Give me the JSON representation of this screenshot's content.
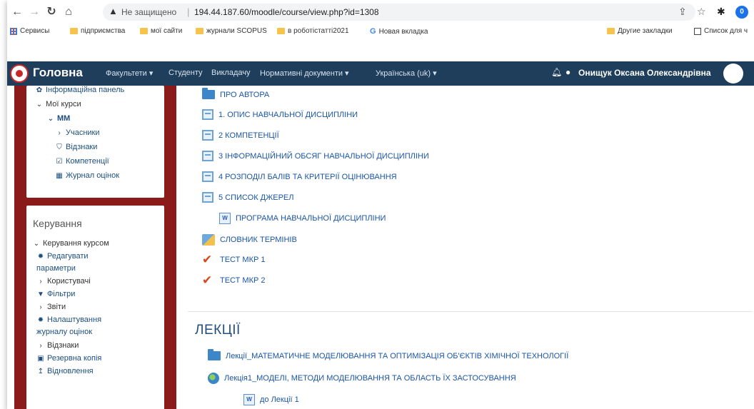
{
  "browser": {
    "not_secure": "Не защищено",
    "url": "194.44.187.60/moodle/course/view.php?id=1308",
    "profile_initial": "0"
  },
  "bookmarks": {
    "left": [
      "Сервисы",
      "підприємства",
      "мої сайти",
      "журнали SCOPUS",
      "в роботістатті2021",
      "Новая вкладка"
    ],
    "right": [
      "Другие закладки",
      "Список для ч"
    ]
  },
  "topnav": {
    "home": "Головна",
    "items": [
      "Факультети ▾",
      "Студенту",
      "Викладачу",
      "Нормативні документи ▾",
      "Українська (uk) ▾"
    ],
    "user": "Онищук Оксана Олександрівна"
  },
  "sidebar": {
    "nav": {
      "dashboard": "Інформаційна панель",
      "my_courses": "Мої курси",
      "course": "ММ",
      "participants": "Учасники",
      "badges": "Відзнаки",
      "competencies": "Компетенції",
      "grades": "Журнал оцінок"
    },
    "admin": {
      "title": "Керування",
      "course_admin": "Керування курсом",
      "edit_settings_1": "Редагувати",
      "edit_settings_2": "параметри",
      "users": "Користувачі",
      "filters": "Фільтри",
      "reports": "Звіти",
      "gradebook_setup_1": "Налаштування",
      "gradebook_setup_2": "журналу оцінок",
      "badges": "Відзнаки",
      "backup": "Резервна копія",
      "restore": "Відновлення"
    }
  },
  "content": {
    "activities": [
      "ПРО АВТОРА",
      "1. ОПИС НАВЧАЛЬНОЇ ДИСЦИПЛІНИ",
      " 2 КОМПЕТЕНЦІЇ",
      "3 ІНФОРМАЦІЙНИЙ ОБСЯГ НАВЧАЛЬНОЇ ДИСЦИПЛІНИ",
      "4 РОЗПОДІЛ БАЛІВ ТА КРИТЕРІЇ ОЦІНЮВАННЯ",
      "5 СПИСОК ДЖЕРЕЛ",
      "ПРОГРАМА НАВЧАЛЬНОЇ ДИСЦИПЛІНИ",
      "СЛОВНИК ТЕРМІНІВ",
      "ТЕСТ МКР 1",
      "ТЕСТ МКР 2"
    ],
    "section_title": "ЛЕКЦІЇ",
    "lectures": [
      "Лекції_МАТЕМАТИЧНЕ МОДЕЛЮВАННЯ ТА ОПТИМІЗАЦІЯ ОБ'ЄКТІВ ХІМІЧНОЇ ТЕХНОЛОГІЇ",
      "Лекція1_МОДЕЛІ, МЕТОДИ МОДЕЛЮВАННЯ ТА ОБЛАСТЬ ЇХ ЗАСТОСУВАННЯ",
      "до Лекції 1"
    ]
  },
  "colors": {
    "navbar": "#1f3e5c",
    "sidebar": "#8b1a1a",
    "link": "#1a55a6"
  }
}
